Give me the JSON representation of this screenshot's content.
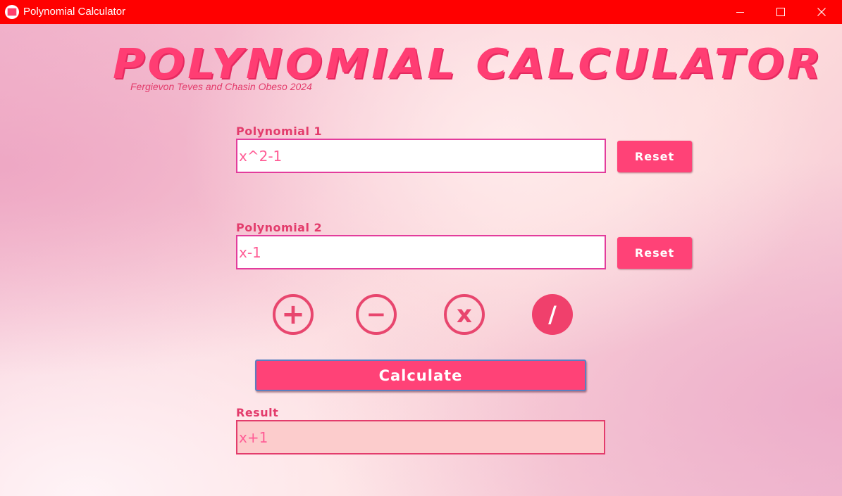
{
  "window": {
    "title": "Polynomial Calculator",
    "icon": "calculator-app-icon",
    "controls": [
      "minimize-icon",
      "maximize-icon",
      "close-icon"
    ]
  },
  "header": {
    "title": "POLYNOMIAL CALCULATOR",
    "subtitle": "Fergievon Teves and Chasin Obeso 2024"
  },
  "poly1": {
    "label": "Polynomial 1",
    "value": "x^2-1",
    "reset_label": "Reset"
  },
  "poly2": {
    "label": "Polynomial 2",
    "value": "x-1",
    "reset_label": "Reset"
  },
  "operations": {
    "add": "+",
    "subtract": "−",
    "multiply": "x",
    "divide": "/",
    "selected": "divide"
  },
  "calculate_label": "Calculate",
  "result": {
    "label": "Result",
    "value": "x+1"
  },
  "colors": {
    "titlebar": "#ff0000",
    "accent": "#ff4277",
    "label": "#e33c6c",
    "result_bg": "#fccccc"
  }
}
